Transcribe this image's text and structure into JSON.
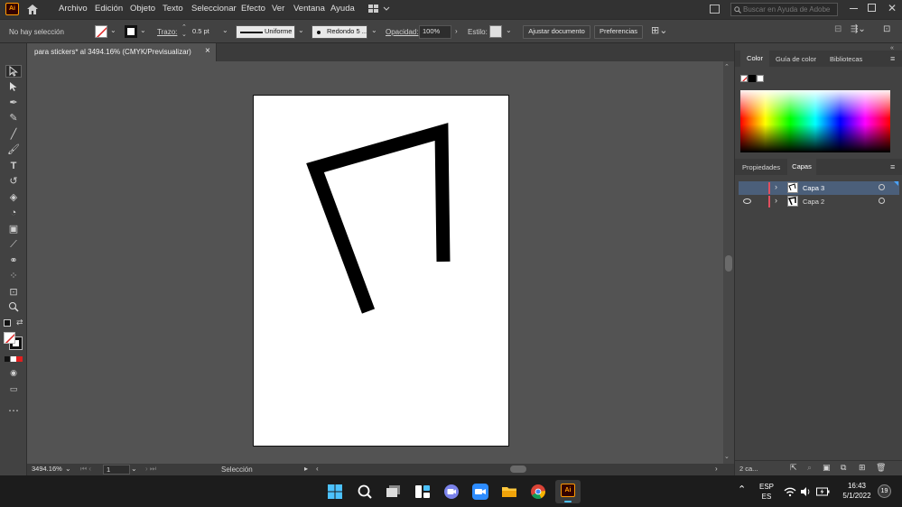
{
  "app": {
    "logo": "Ai"
  },
  "menu": [
    "Archivo",
    "Edición",
    "Objeto",
    "Texto",
    "Seleccionar",
    "Efecto",
    "Ver",
    "Ventana",
    "Ayuda"
  ],
  "help_search": {
    "placeholder": "Buscar en Ayuda de Adobe"
  },
  "control_bar": {
    "selection_state": "No hay selección",
    "stroke_label": "Trazo:",
    "stroke_value": "0.5 pt",
    "profile": "Uniforme",
    "brush": "Redondo 5 ...",
    "opacity_label": "Opacidad:",
    "opacity_value": "100%",
    "style_label": "Estilo:",
    "fit_document": "Ajustar documento",
    "preferences": "Preferencias"
  },
  "document_tab": {
    "title": "para stickers* al 3494.16% (CMYK/Previsualizar)",
    "close": "×"
  },
  "status": {
    "zoom": "3494.16%",
    "artboard": "1",
    "tool": "Selección"
  },
  "panels": {
    "color_tabs": [
      "Color",
      "Guía de color",
      "Bibliotecas"
    ],
    "layers_tabs": [
      "Propiedades",
      "Capas"
    ],
    "layers": [
      {
        "name": "Capa 3",
        "visible": false,
        "selected": true
      },
      {
        "name": "Capa 2",
        "visible": true,
        "selected": false
      }
    ],
    "layers_count": "2 ca..."
  },
  "taskbar": {
    "lang": "ESP",
    "lang_sub": "ES",
    "time": "16:43",
    "date": "5/1/2022",
    "notifications": "19"
  },
  "colors": {
    "accent_layer": "#e04f5f",
    "selected_row": "#4b5f7a",
    "app_badge": "#330000",
    "app_badge_text": "#ff9a00"
  },
  "icons": [
    "home-icon",
    "workspace-icon",
    "arrange-icon",
    "selection-tool-icon",
    "direct-selection-tool-icon",
    "pen-tool-icon",
    "curvature-tool-icon",
    "line-tool-icon",
    "paintbrush-tool-icon",
    "type-tool-icon",
    "rotate-tool-icon",
    "eraser-tool-icon",
    "shape-builder-tool-icon",
    "gradient-tool-icon",
    "eyedropper-tool-icon",
    "blend-tool-icon",
    "symbol-sprayer-tool-icon",
    "artboard-tool-icon",
    "zoom-tool-icon",
    "more-tools-icon",
    "eye-icon",
    "windows-start-icon",
    "search-icon",
    "chrome-icon",
    "wifi-icon",
    "volume-icon",
    "battery-icon"
  ]
}
